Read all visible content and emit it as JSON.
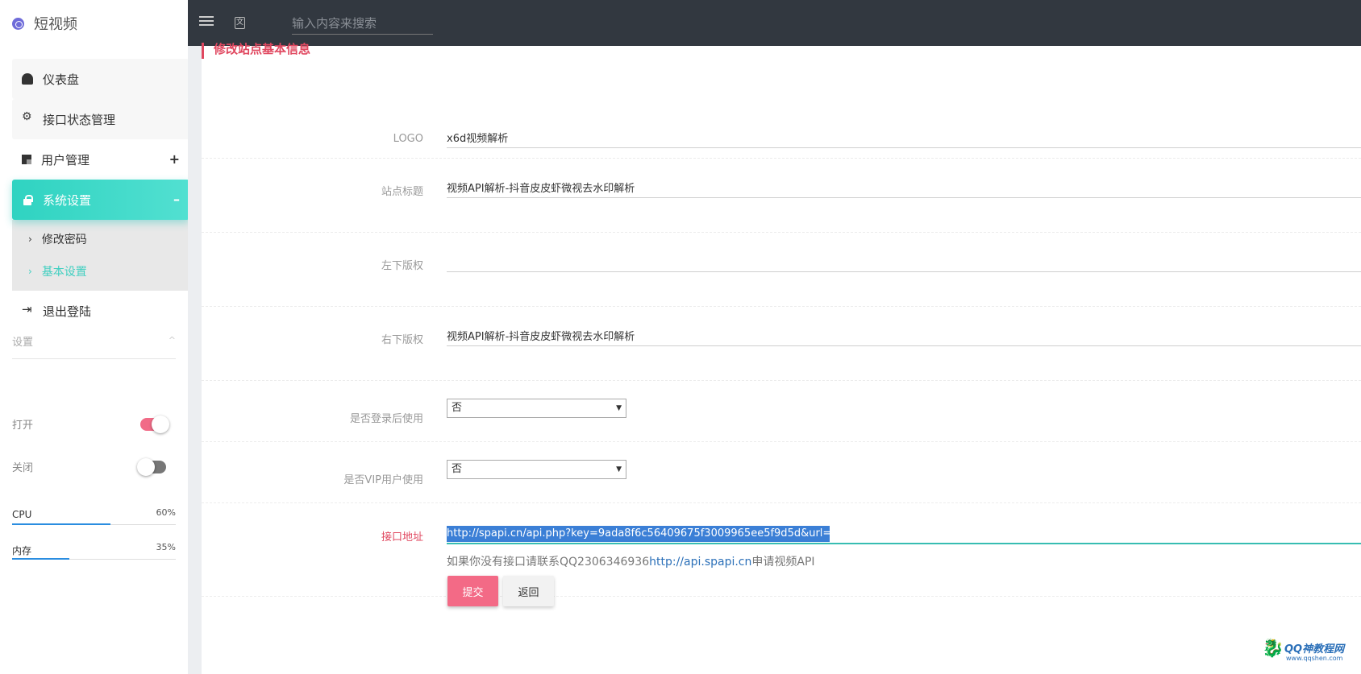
{
  "brand": {
    "name": "短视频"
  },
  "sidebar": {
    "items": [
      {
        "label": "仪表盘"
      },
      {
        "label": "接口状态管理"
      },
      {
        "label": "用户管理",
        "extra": "+"
      },
      {
        "label": "系统设置",
        "extra": "–"
      },
      {
        "label": "退出登陆"
      }
    ],
    "submenu": [
      {
        "label": "修改密码"
      },
      {
        "label": "基本设置"
      }
    ],
    "settings_title": "设置",
    "switches": [
      {
        "label": "打开",
        "state": "on"
      },
      {
        "label": "关闭",
        "state": "off"
      }
    ],
    "meters": [
      {
        "label": "CPU",
        "value": "60%",
        "fraction": 0.6
      },
      {
        "label": "内存",
        "value": "35%",
        "fraction": 0.35
      }
    ]
  },
  "topbar": {
    "search_placeholder": "输入内容来搜索"
  },
  "form": {
    "title": "修改站点基本信息",
    "fields": {
      "logo": {
        "label": "LOGO",
        "value": "x6d视频解析"
      },
      "site_title": {
        "label": "站点标题",
        "value": "视频API解析-抖音皮皮虾微视去水印解析"
      },
      "copyright_left": {
        "label": "左下版权",
        "value": ""
      },
      "copyright_right": {
        "label": "右下版权",
        "value": "视频API解析-抖音皮皮虾微视去水印解析"
      },
      "login_required": {
        "label": "是否登录后使用",
        "value": "否"
      },
      "vip_required": {
        "label": "是否VIP用户使用",
        "value": "否"
      },
      "api_url": {
        "label": "接口地址",
        "value": "http://spapi.cn/api.php?key=9ada8f6c56409675f3009965ee5f9d5d&url="
      }
    },
    "help": {
      "prefix": "如果你没有接口请联系QQ2306346936",
      "link": "http://api.spapi.cn",
      "suffix": "申请视频API"
    },
    "submit_label": "提交",
    "back_label": "返回"
  },
  "watermark": {
    "text": "QQ神教程网",
    "url": "www.qqshen.com"
  },
  "colors": {
    "accent_teal": "#3ecfc0",
    "accent_pink": "#f36a86",
    "topbar": "#323840"
  }
}
